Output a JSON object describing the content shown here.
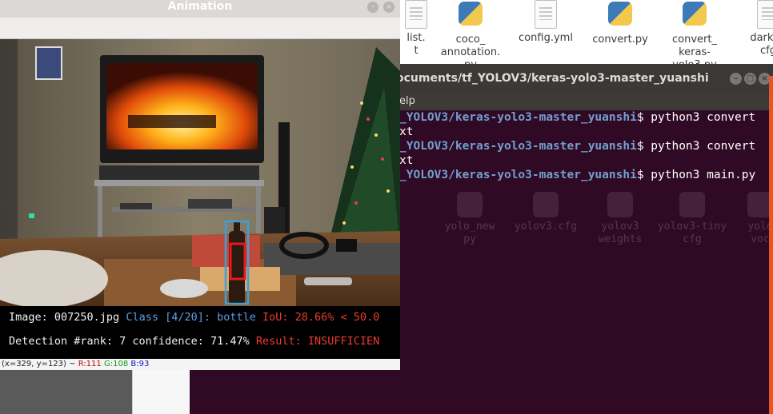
{
  "desktop": {
    "files": [
      {
        "name": "list.\nt",
        "icon": "text-file-icon"
      },
      {
        "name": "coco_\nannotation.\npy",
        "icon": "python-file-icon"
      },
      {
        "name": "config.yml",
        "icon": "text-file-icon"
      },
      {
        "name": "convert.py",
        "icon": "python-file-icon"
      },
      {
        "name": "convert_\nkeras-\nyolo3.py",
        "icon": "python-file-icon"
      },
      {
        "name": "darkne\ncfg",
        "icon": "text-file-icon"
      }
    ]
  },
  "terminal": {
    "title": "ocuments/tf_YOLOV3/keras-yolo3-master_yuanshi",
    "menu": "elp",
    "lines": [
      {
        "path": "_YOLOV3/keras-yolo3-master_yuanshi",
        "cmd": "$ python3 convert"
      },
      {
        "plain": "xt"
      },
      {
        "path": "_YOLOV3/keras-yolo3-master_yuanshi",
        "cmd": "$ python3 convert"
      },
      {
        "plain": "xt"
      },
      {
        "path": "_YOLOV3/keras-yolo3-master_yuanshi",
        "cmd": "$ python3 main.py"
      }
    ],
    "ghost_files": [
      {
        "name": "yolo_new\npy"
      },
      {
        "name": "yolov3.cfg"
      },
      {
        "name": "yolov3\nweights"
      },
      {
        "name": "yolov3-tiny\ncfg"
      },
      {
        "name": "yolo\nvoc"
      }
    ],
    "colors": {
      "background": "#300a24",
      "path": "#729fcf",
      "accent": "#e95420"
    }
  },
  "animation_window": {
    "title": "Animation",
    "info": {
      "image_label": "Image: 007250.jpg",
      "class_label": "Class [4/20]: bottle",
      "iou_label": "IoU: 28.66% < 50.0",
      "detection_label": "Detection #rank: 7 confidence: 71.47%",
      "result_label": "Result: INSUFFICIEN"
    },
    "status": {
      "coords": "(x=329, y=123) ~",
      "r": "R:111",
      "g": "G:108",
      "b": "B:93"
    },
    "colors": {
      "gt_box": "#3ba0e0",
      "pred_box": "#e81a1a"
    }
  }
}
